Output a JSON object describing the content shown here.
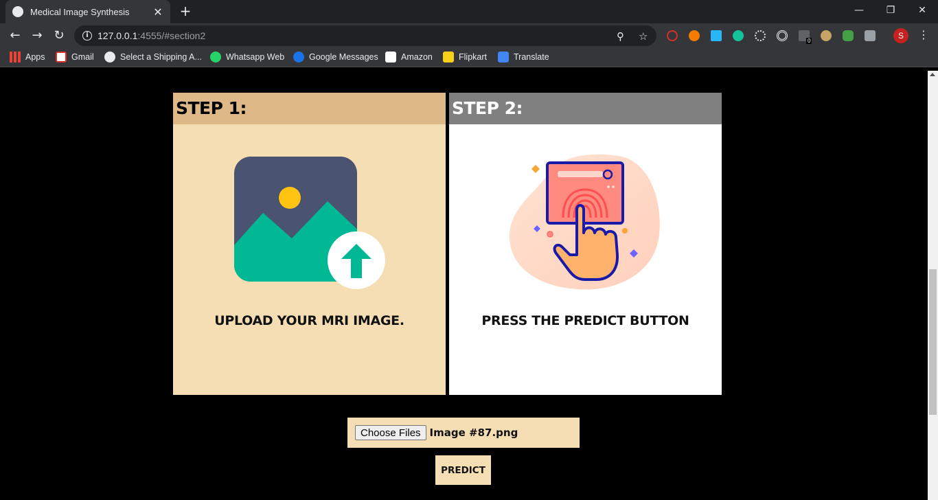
{
  "browser": {
    "tab": {
      "title": "Medical Image Synthesis",
      "close_glyph": "✕"
    },
    "new_tab_glyph": "+",
    "window_controls": {
      "minimize": "—",
      "restore": "❐",
      "close": "✕"
    },
    "nav": {
      "back": "←",
      "forward": "→",
      "reload": "↻"
    },
    "address": {
      "host": "127.0.0.1",
      "rest": ":4555/#section2"
    },
    "omnibox_icons": {
      "zoom": "⚲",
      "star": "☆"
    },
    "extension_badge": "0",
    "profile_initial": "S",
    "menu_glyph": "⋮",
    "bookmarks": [
      {
        "label": "Apps",
        "icon": "apps-grid-icon",
        "color": "#ea4335"
      },
      {
        "label": "Gmail",
        "icon": "gmail-icon",
        "color": "#d93025"
      },
      {
        "label": "Select a Shipping A...",
        "icon": "globe-icon",
        "color": "#e8eaed"
      },
      {
        "label": "Whatsapp Web",
        "icon": "whatsapp-icon",
        "color": "#25d366"
      },
      {
        "label": "Google Messages",
        "icon": "messages-icon",
        "color": "#1a73e8"
      },
      {
        "label": "Amazon",
        "icon": "amazon-icon",
        "color": "#ffffff"
      },
      {
        "label": "Flipkart",
        "icon": "flipkart-icon",
        "color": "#f7d117"
      },
      {
        "label": "Translate",
        "icon": "translate-icon",
        "color": "#4285f4"
      }
    ]
  },
  "steps": [
    {
      "heading": "STEP 1:",
      "caption": "UPLOAD YOUR MRI IMAGE.",
      "head_color": "#deb887",
      "body_color": "#f5deb3",
      "heading_color": "#000000",
      "illustration": "image-upload-icon"
    },
    {
      "heading": "STEP 2:",
      "caption": "PRESS THE PREDICT BUTTON",
      "head_color": "#808080",
      "body_color": "#ffffff",
      "heading_color": "#ffffff",
      "illustration": "fingerprint-press-icon"
    }
  ],
  "upload": {
    "button_label": "Choose Files",
    "file_name": "Image #87.png"
  },
  "predict": {
    "label": "PREDICT"
  },
  "colors": {
    "accent": "#f5deb3",
    "upload_green": "#00b894",
    "slate": "#4a5470",
    "sun": "#ffc312"
  }
}
